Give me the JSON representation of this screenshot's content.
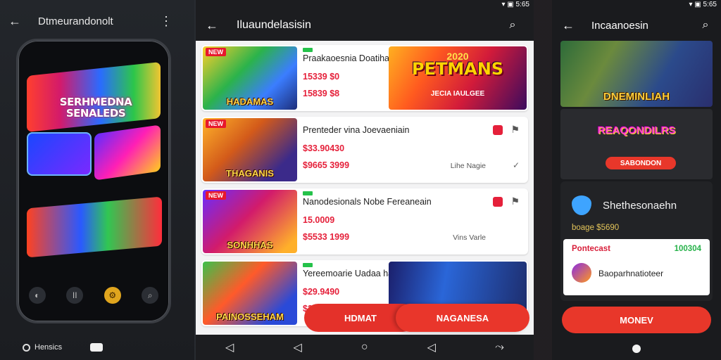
{
  "panel1": {
    "title": "Dtmeurandonolt",
    "back_icon": "←",
    "more_icon": "⋮",
    "phone_banner": "SERHMEDNA\nSENALEDS",
    "dock": [
      "◐",
      "II",
      "⚙",
      "⌕"
    ],
    "footer_label": "Hensics"
  },
  "panel2": {
    "status": "▾ ▣ 5:65",
    "title": "Iluaundelasisin",
    "back_icon": "←",
    "search_icon": "⌕",
    "cards": [
      {
        "badge": "NEW",
        "thumb_label": "HADAMAS",
        "name": "Praakaoesnia Doatiha",
        "price": "15339 $0",
        "price2": "15839 $8",
        "banner_big": "PETMANS",
        "banner_small": "JECIA IAULGEE",
        "banner_year": "2020"
      },
      {
        "badge": "NEW",
        "thumb_label": "THAGANIS",
        "name": "Prenteder vina Joevaeniain",
        "price": "$33.90430",
        "price2": "$9665 3999",
        "note": "Lihe Nagie"
      },
      {
        "badge": "NEW",
        "thumb_label": "SONHHAS",
        "name": "Nanodesionals Nobe Fereaneain",
        "price": "15.0009",
        "price2": "$5533 1999",
        "note": "Vins Varle"
      },
      {
        "badge": "NEW",
        "thumb_label": "PAINOSSEHAM",
        "name": "Yereemoarie Uadaa hade",
        "price": "$29.9490",
        "price2": "$209"
      }
    ],
    "buttons": {
      "left": "HDMAT",
      "right": "NAGANESA"
    },
    "nav": [
      "◁",
      "◁",
      "○",
      "◁",
      "⤳"
    ]
  },
  "panel3": {
    "status": "▾ ▣ 5:65",
    "title": "Incaanoesin",
    "back_icon": "←",
    "search_icon": "⌕",
    "hero_label": "DNEMINLIAH",
    "promo_logo": "REAQONDILRS",
    "promo_button": "SABONDON",
    "info_title": "Shethesonaehn",
    "info_price": "boage $5690",
    "info_row1_left": "Pontecast",
    "info_row1_right": "100304",
    "info_row2": "Baoparhnatioteer",
    "cta": "MONEV"
  }
}
